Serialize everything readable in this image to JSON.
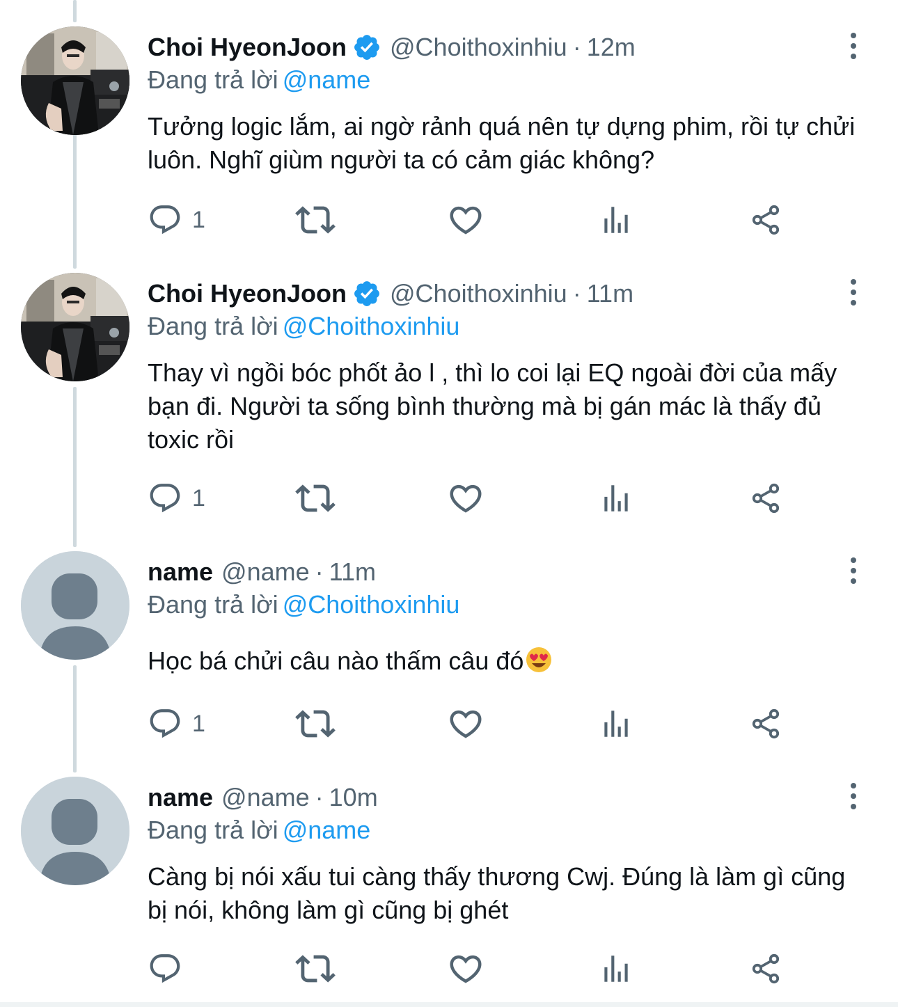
{
  "colors": {
    "accent": "#1d9bf0",
    "secondary_text": "#536471",
    "primary_text": "#0f1419",
    "thread_line": "#cfd9de",
    "default_avatar_bg": "#c9d4db",
    "default_avatar_fg": "#6e7f8d"
  },
  "tweets": [
    {
      "name": "Choi HyeonJoon",
      "verified": true,
      "handle": "@Choithoxinhiu",
      "separator": "·",
      "time": "12m",
      "reply_prefix": "Đang trả lời",
      "reply_to": "@name",
      "text": "Tưởng logic lắm, ai ngờ rảnh quá nên tự dựng phim, rồi tự chửi luôn. Nghĩ giùm người ta có cảm giác không?",
      "reply_count": "1",
      "avatar": "profile-photo"
    },
    {
      "name": "Choi HyeonJoon",
      "verified": true,
      "handle": "@Choithoxinhiu",
      "separator": "·",
      "time": "11m",
      "reply_prefix": "Đang trả lời",
      "reply_to": "@Choithoxinhiu",
      "text": "Thay vì ngồi bóc phốt ảo l , thì lo coi lại EQ ngoài đời của mấy bạn đi. Người ta sống bình thường mà bị gán mác là thấy đủ toxic rồi",
      "reply_count": "1",
      "avatar": "profile-photo"
    },
    {
      "name": "name",
      "verified": false,
      "handle": "@name",
      "separator": "·",
      "time": "11m",
      "reply_prefix": "Đang trả lời",
      "reply_to": "@Choithoxinhiu",
      "text": "Học bá chửi câu nào thấm câu đó",
      "emoji": "heart-eyes-emoji",
      "reply_count": "1",
      "avatar": "default-avatar"
    },
    {
      "name": "name",
      "verified": false,
      "handle": "@name",
      "separator": "·",
      "time": "10m",
      "reply_prefix": "Đang trả lời",
      "reply_to": "@name",
      "text": "Càng bị nói xấu tui càng thấy thương Cwj. Đúng là làm gì cũng bị nói, không làm gì cũng bị ghét",
      "reply_count": "",
      "avatar": "default-avatar"
    }
  ],
  "icons": {
    "reply": "reply-icon",
    "retweet": "retweet-icon",
    "like": "heart-icon",
    "analytics": "analytics-icon",
    "share": "share-icon",
    "more": "more-vertical-icon",
    "verified": "verified-badge-icon"
  }
}
